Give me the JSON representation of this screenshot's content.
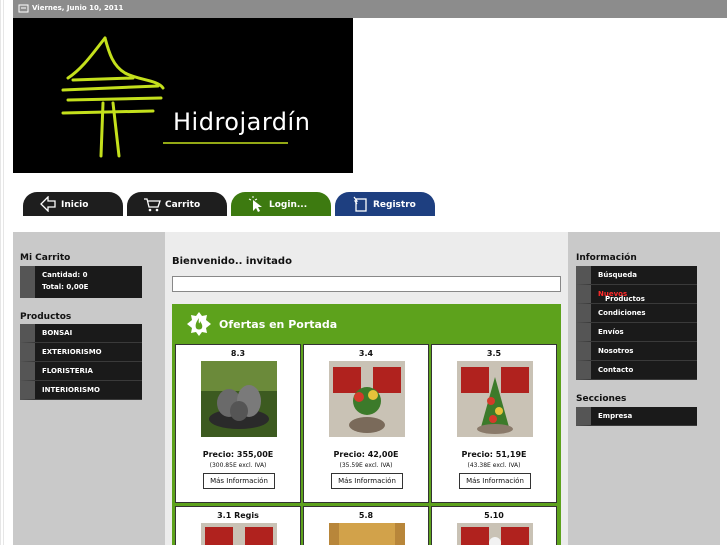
{
  "header": {
    "date": "Viernes, Junio 10, 2011",
    "logo_text": "Hidrojardín"
  },
  "nav": [
    {
      "label": "Inicio",
      "icon": "arrow-left-icon"
    },
    {
      "label": "Carrito",
      "icon": "cart-icon"
    },
    {
      "label": "Login...",
      "icon": "cursor-click-icon"
    },
    {
      "label": "Registro",
      "icon": "register-icon"
    }
  ],
  "left": {
    "cart_title": "Mi Carrito",
    "cart_quantity": "Cantidad: 0",
    "cart_total": "Total: 0,00E",
    "products_title": "Productos",
    "products": [
      "BONSAI",
      "EXTERIORISMO",
      "FLORISTERIA",
      "INTERIORISMO"
    ]
  },
  "center": {
    "welcome": "Bienvenido.. invitado",
    "ofertas_title": "Ofertas en Portada",
    "cards": [
      {
        "code": "8.3",
        "price": "Precio: 355,00E",
        "excl": "(300.85E excl. IVA)",
        "button": "Más Información"
      },
      {
        "code": "3.4",
        "price": "Precio: 42,00E",
        "excl": "(35.59E excl. IVA)",
        "button": "Más Información"
      },
      {
        "code": "3.5",
        "price": "Precio: 51,19E",
        "excl": "(43.38E excl. IVA)",
        "button": "Más Información"
      },
      {
        "code": "3.1 Regis"
      },
      {
        "code": "5.8"
      },
      {
        "code": "5.10"
      }
    ]
  },
  "right": {
    "info_title": "Información",
    "info_items": [
      "Búsqueda",
      "Productos",
      "Condiciones",
      "Envíos",
      "Nosotros",
      "Contacto"
    ],
    "info_new_label": "Nuevos",
    "sections_title": "Secciones",
    "sections_items": [
      "Empresa"
    ]
  },
  "colors": {
    "green": "#5da21c",
    "nav_dark": "#1e1e1e",
    "nav_green": "#3d7a10",
    "nav_blue": "#1e3f80",
    "new_red": "#ff2a2a"
  }
}
